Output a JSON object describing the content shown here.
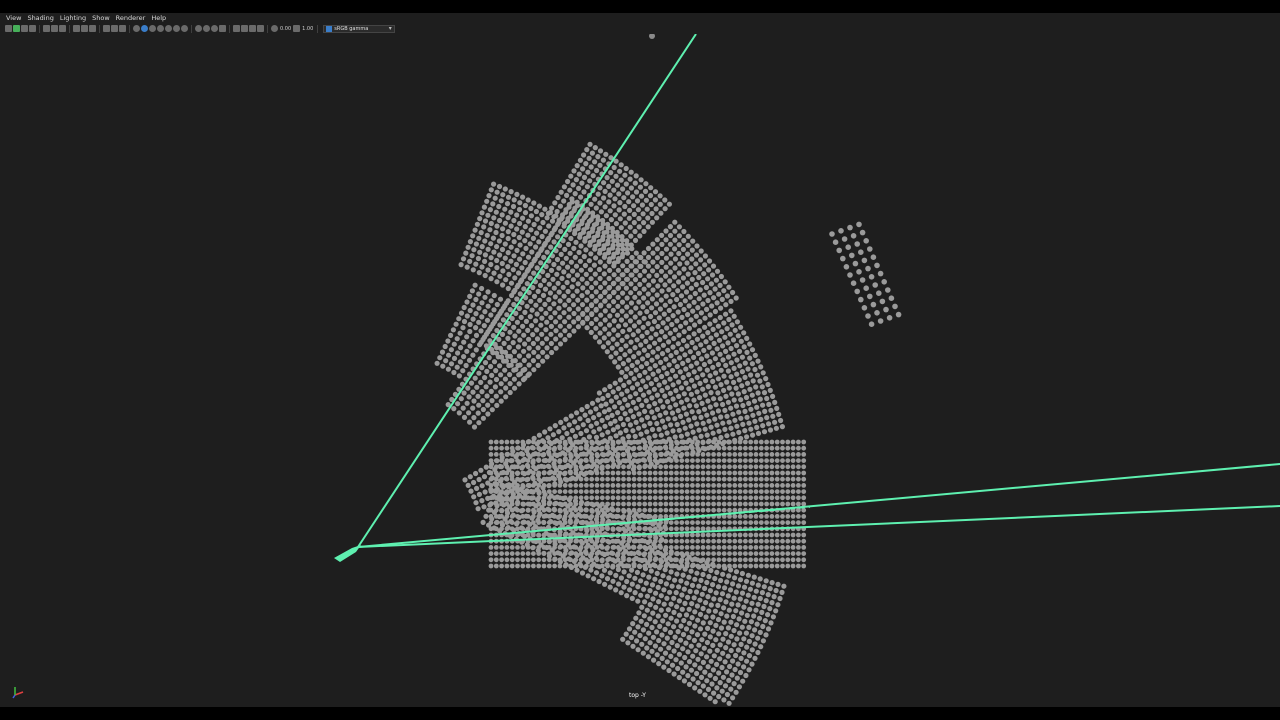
{
  "menu": [
    "View",
    "Shading",
    "Lighting",
    "Show",
    "Renderer",
    "Help"
  ],
  "toolbar": {
    "field_a": "0.00",
    "field_b": "1.00",
    "camera_select": "sRGB gamma"
  },
  "viewport": {
    "camera_label": "top -Y",
    "background_color": "#1e1e1e",
    "seat_color": "#9a9a9a",
    "camera_color": "#5ef0b0"
  },
  "icons": {
    "camera_select_icon": "color-management-icon",
    "dropdown_icon": "chevron-down-icon",
    "axis_gizmo": "axis-gizmo-icon"
  }
}
